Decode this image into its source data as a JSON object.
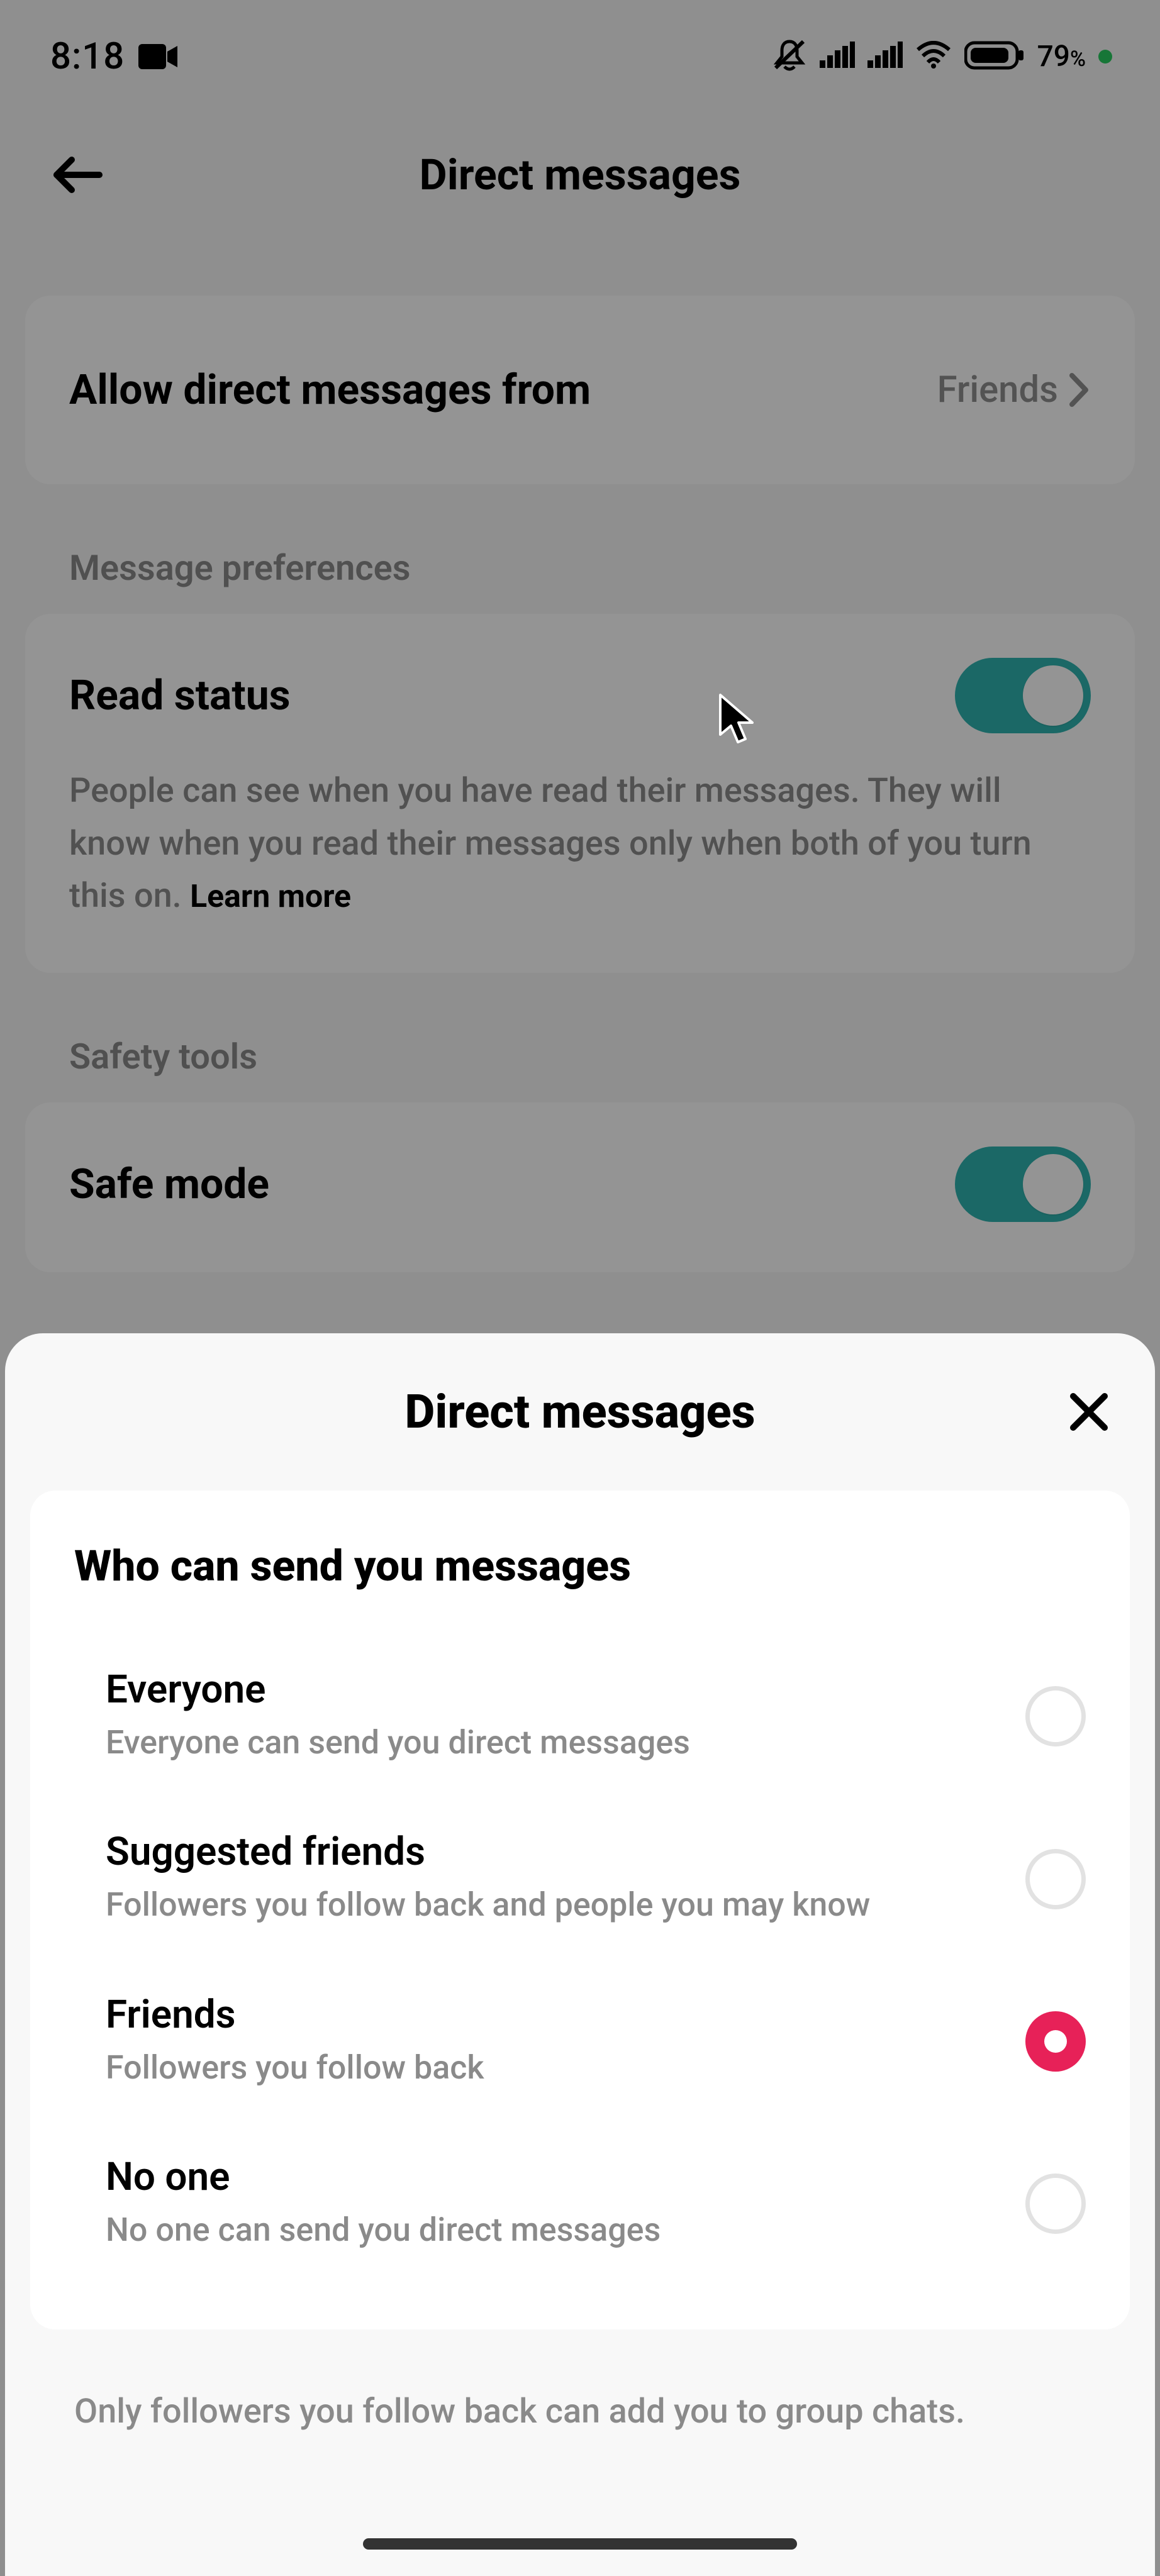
{
  "status_bar": {
    "time": "8:18",
    "battery_text": "79",
    "battery_unit": "%"
  },
  "app_bar": {
    "title": "Direct messages"
  },
  "allow_dm": {
    "label": "Allow direct messages from",
    "value": "Friends"
  },
  "sections": {
    "message_prefs": "Message preferences",
    "safety_tools": "Safety tools"
  },
  "read_status": {
    "title": "Read status",
    "desc": "People can see when you have read their messages. They will know when you read their messages only when both of you turn this on. ",
    "learn_more": "Learn more",
    "enabled": true
  },
  "safe_mode": {
    "title": "Safe mode",
    "enabled": true
  },
  "sheet": {
    "title": "Direct messages",
    "section_title": "Who can send you messages",
    "options": [
      {
        "title": "Everyone",
        "desc": "Everyone can send you direct messages",
        "selected": false
      },
      {
        "title": "Suggested friends",
        "desc": "Followers you follow back and people you may know",
        "selected": false
      },
      {
        "title": "Friends",
        "desc": "Followers you follow back",
        "selected": true
      },
      {
        "title": "No one",
        "desc": "No one can send you direct messages",
        "selected": false
      }
    ],
    "footnote": "Only followers you follow back can add you to group chats."
  }
}
